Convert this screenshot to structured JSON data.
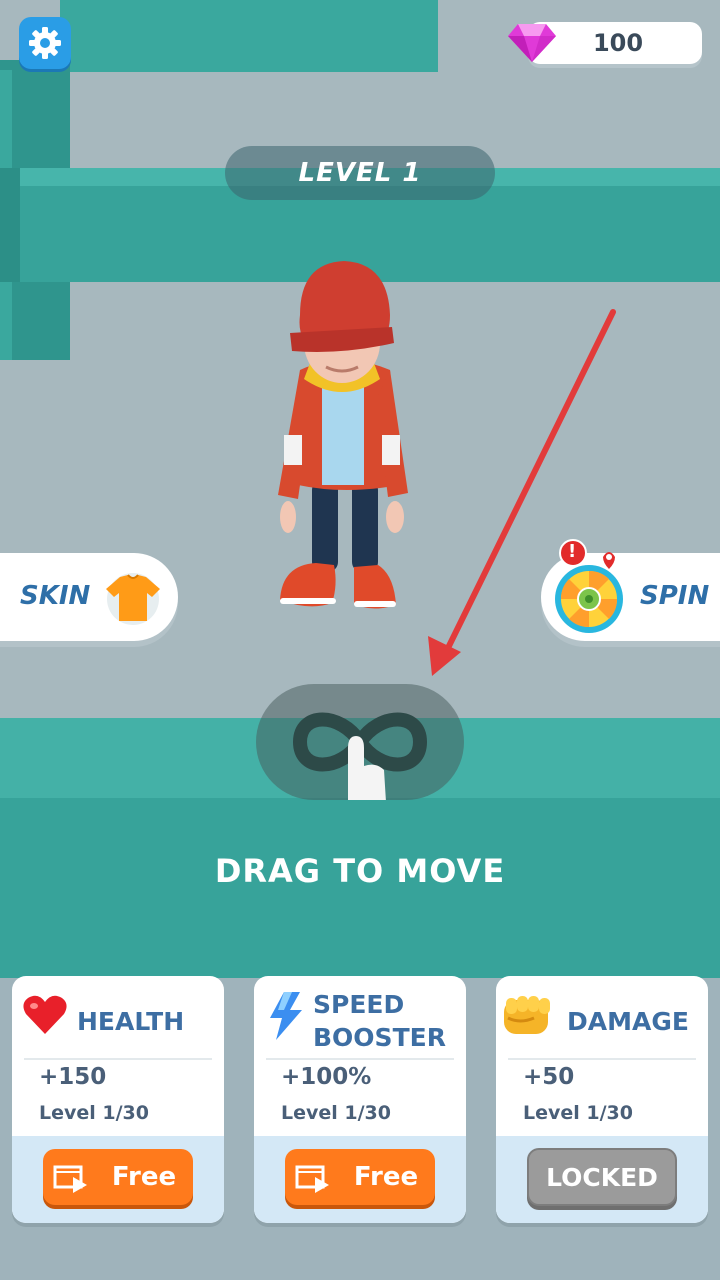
{
  "hud": {
    "level_label": "LEVEL 1",
    "gems_count": "100",
    "settings_icon": "gear-icon",
    "gem_icon": "pink-diamond-icon"
  },
  "side_buttons": {
    "skin_label": "SKIN",
    "skin_icon": "tshirt-icon",
    "spin_label": "SPIN",
    "spin_icon": "prize-wheel-icon",
    "spin_alert": "!"
  },
  "tutorial": {
    "instruction": "DRAG TO MOVE",
    "gesture_icon": "infinity-swipe-hand-icon"
  },
  "upgrades": [
    {
      "title_line1": "HEALTH",
      "title_line2": "",
      "icon": "heart-icon",
      "value": "+150",
      "level": "Level 1/30",
      "button": "Free",
      "button_state": "free"
    },
    {
      "title_line1": "SPEED",
      "title_line2": "BOOSTER",
      "icon": "lightning-icon",
      "value": "+100%",
      "level": "Level 1/30",
      "button": "Free",
      "button_state": "free"
    },
    {
      "title_line1": "DAMAGE",
      "title_line2": "",
      "icon": "fist-icon",
      "value": "+50",
      "level": "Level 1/30",
      "button": "LOCKED",
      "button_state": "locked"
    }
  ],
  "colors": {
    "teal_wall": "#3aa89e",
    "floor": "#a7b8be",
    "accent_blue": "#2e6fa8",
    "free_orange": "#ff7a1c",
    "locked_gray": "#9b9b9b",
    "gem_pink": "#e03ad8"
  }
}
